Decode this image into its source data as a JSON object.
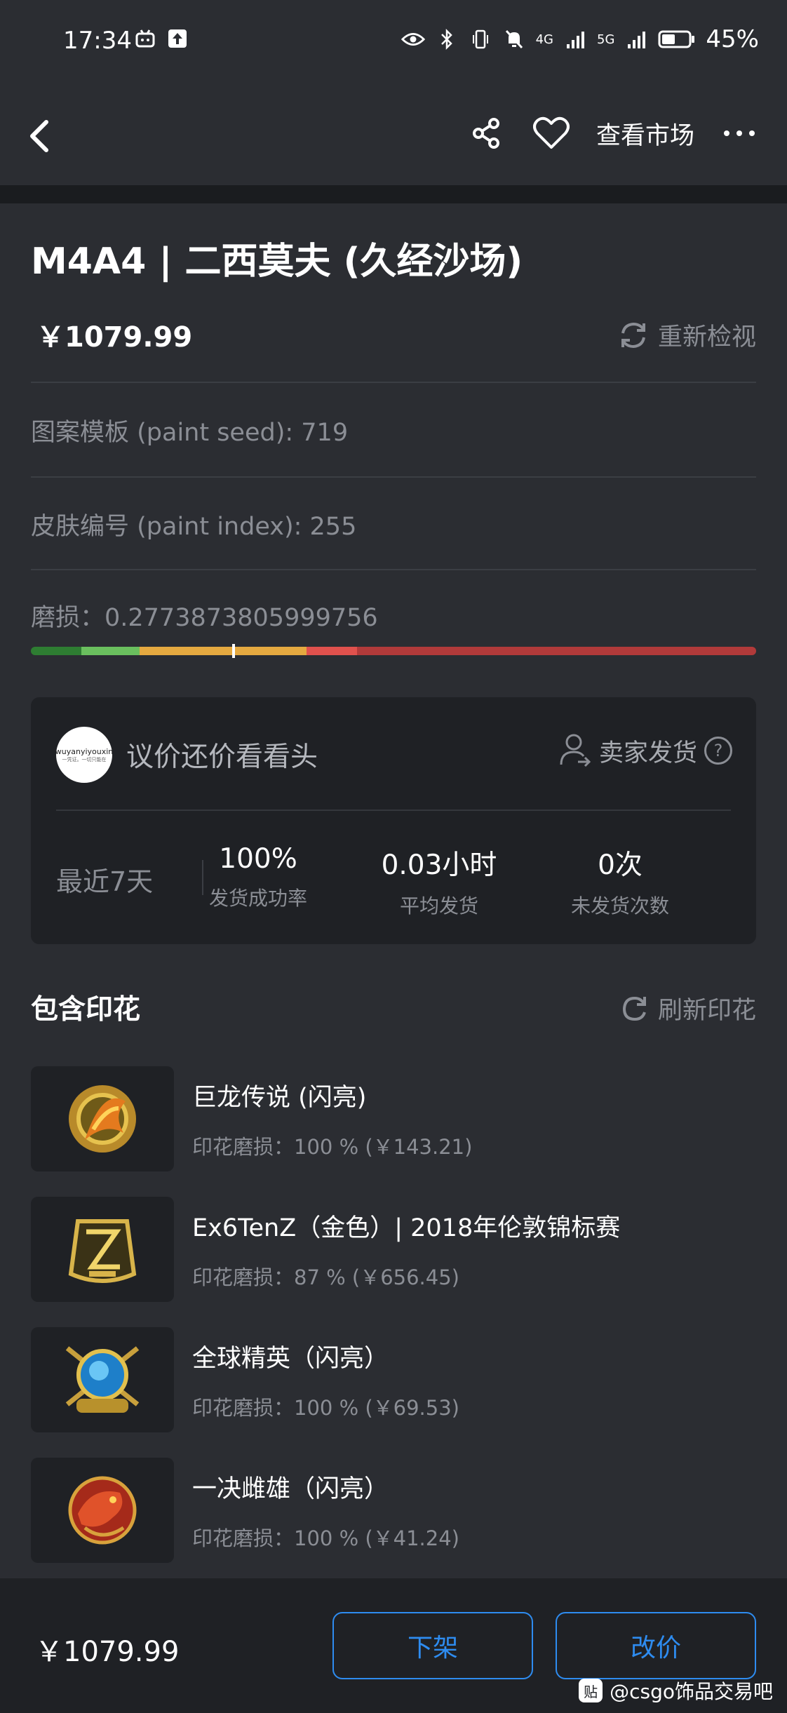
{
  "status_bar": {
    "time": "17:34",
    "network_4g": "4G",
    "network_5g": "5G",
    "battery": "45%"
  },
  "nav": {
    "market_label": "查看市场"
  },
  "item": {
    "title": "M4A4 | 二西莫夫 (久经沙场)",
    "price": "￥1079.99",
    "reinspect_label": "重新检视",
    "paint_seed": "图案模板 (paint seed): 719",
    "paint_index": "皮肤编号 (paint index): 255",
    "float": "磨损：0.2773873805999756",
    "float_value": 0.2773873805999756
  },
  "wear_bar_colors": [
    "#2e7d32",
    "#6abf5e",
    "#e5a940",
    "#e5a940",
    "#e0514d",
    "#b13a3a"
  ],
  "seller": {
    "avatar_text": "wuyanyiyouxin",
    "avatar_subtext": "一凭证。一切只能在",
    "name": "议价还价看看头",
    "ship_label": "卖家发货",
    "help_glyph": "?",
    "period": "最近7天",
    "stats": [
      {
        "value": "100%",
        "label": "发货成功率"
      },
      {
        "value": "0.03小时",
        "label": "平均发货"
      },
      {
        "value": "0次",
        "label": "未发货次数"
      }
    ]
  },
  "stickers_section": {
    "title": "包含印花",
    "refresh_label": "刷新印花",
    "items": [
      {
        "name": "巨龙传说 (闪亮)",
        "wear": "印花磨损：100 % (￥143.21)"
      },
      {
        "name": "Ex6TenZ（金色）| 2018年伦敦锦标赛",
        "wear": "印花磨损：87 % (￥656.45)"
      },
      {
        "name": "全球精英（闪亮）",
        "wear": "印花磨损：100 % (￥69.53)"
      },
      {
        "name": "一决雌雄（闪亮）",
        "wear": "印花磨损：100 % (￥41.24)"
      }
    ]
  },
  "bottom": {
    "price": "￥1079.99",
    "delist_label": "下架",
    "reprice_label": "改价"
  },
  "watermark": {
    "badge": "贴",
    "text": "@csgo饰品交易吧"
  },
  "colors": {
    "background": "#2b2d32",
    "card": "#1f2125",
    "accent": "#2e8cf0",
    "muted_text": "#8b8e95"
  }
}
